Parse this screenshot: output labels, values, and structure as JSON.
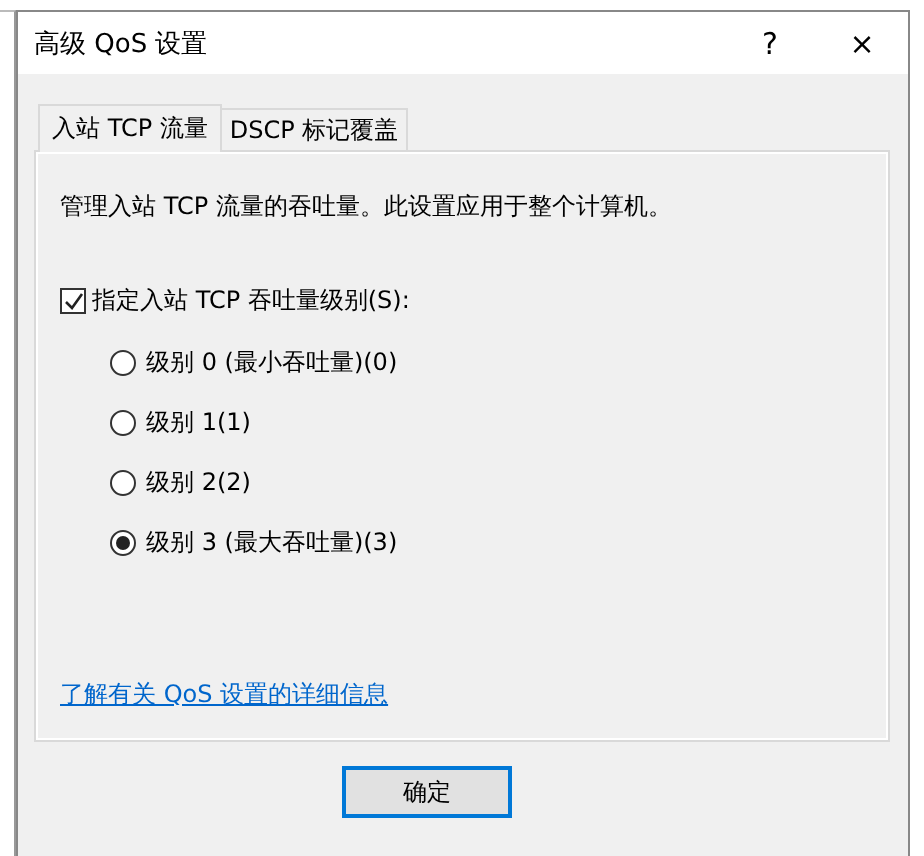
{
  "window": {
    "title": "高级 QoS 设置",
    "help": "?",
    "close": "×"
  },
  "tabs": [
    {
      "label": "入站 TCP 流量",
      "selected": true
    },
    {
      "label": "DSCP 标记覆盖",
      "selected": false
    }
  ],
  "description": "管理入站 TCP 流量的吞吐量。此设置应用于整个计算机。",
  "option": {
    "label": "指定入站 TCP 吞吐量级别(S):",
    "checked": true
  },
  "levels": [
    {
      "label": "级别 0 (最小吞吐量)(0)",
      "selected": false
    },
    {
      "label": "级别 1(1)",
      "selected": false
    },
    {
      "label": "级别 2(2)",
      "selected": false
    },
    {
      "label": "级别 3 (最大吞吐量)(3)",
      "selected": true
    }
  ],
  "link": "了解有关 QoS 设置的详细信息",
  "buttons": [
    "确定"
  ]
}
